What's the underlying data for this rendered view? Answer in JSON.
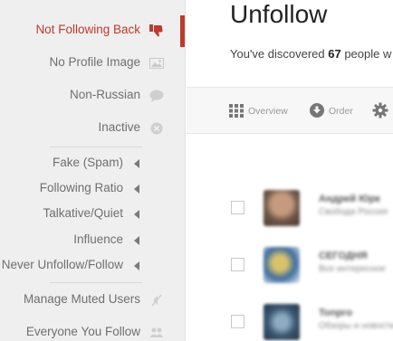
{
  "sidebar": {
    "items": [
      {
        "label": "Not Following Back",
        "icon": "thumbs-down-icon",
        "active": true
      },
      {
        "label": "No Profile Image",
        "icon": "image-icon"
      },
      {
        "label": "Non-Russian",
        "icon": "speech-bubble-icon"
      },
      {
        "label": "Inactive",
        "icon": "cancel-circle-icon"
      },
      {
        "label": "Fake (Spam)",
        "icon": "caret-left-icon"
      },
      {
        "label": "Following Ratio",
        "icon": "caret-left-icon"
      },
      {
        "label": "Talkative/Quiet",
        "icon": "caret-left-icon"
      },
      {
        "label": "Influence",
        "icon": "caret-left-icon"
      },
      {
        "label": "Never Unfollow/Follow",
        "icon": "caret-left-icon"
      },
      {
        "label": "Manage Muted Users",
        "icon": "mute-icon"
      },
      {
        "label": "Everyone You Follow",
        "icon": "users-icon"
      }
    ],
    "accent_color": "#c0392b"
  },
  "main": {
    "title": "Unfollow",
    "subtitle_prefix": "You've discovered ",
    "count": "67",
    "subtitle_suffix": " people w",
    "toolbar": [
      {
        "label": "Overview",
        "icon": "grid-icon"
      },
      {
        "label": "Order",
        "icon": "order-icon"
      },
      {
        "label": "",
        "icon": "gear-icon"
      }
    ],
    "users": [
      {
        "name": "Андрей Юрк",
        "meta": "Свобода Россия"
      },
      {
        "name": "СЕГОДНЯ",
        "meta": "Все интересное"
      },
      {
        "name": "Tonpro",
        "meta": "Обзоры и новости"
      }
    ]
  }
}
